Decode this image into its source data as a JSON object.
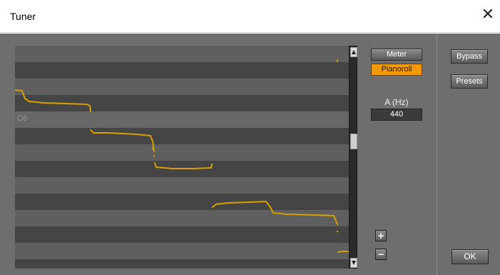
{
  "window": {
    "title": "Tuner",
    "close_symbol": "✕"
  },
  "roll": {
    "note_labels": [
      {
        "text": "C6"
      }
    ],
    "trace_color": "#d6a000"
  },
  "controls": {
    "meter_label": "Meter",
    "pianoroll_label": "Pianoroll",
    "hz_label": "A (Hz)",
    "hz_value": "440",
    "zoom_in": "+",
    "zoom_out": "−",
    "bypass_label": "Bypass",
    "presets_label": "Presets",
    "ok_label": "OK"
  },
  "colors": {
    "active": "#f39a00",
    "panel": "#6e6e6e"
  }
}
